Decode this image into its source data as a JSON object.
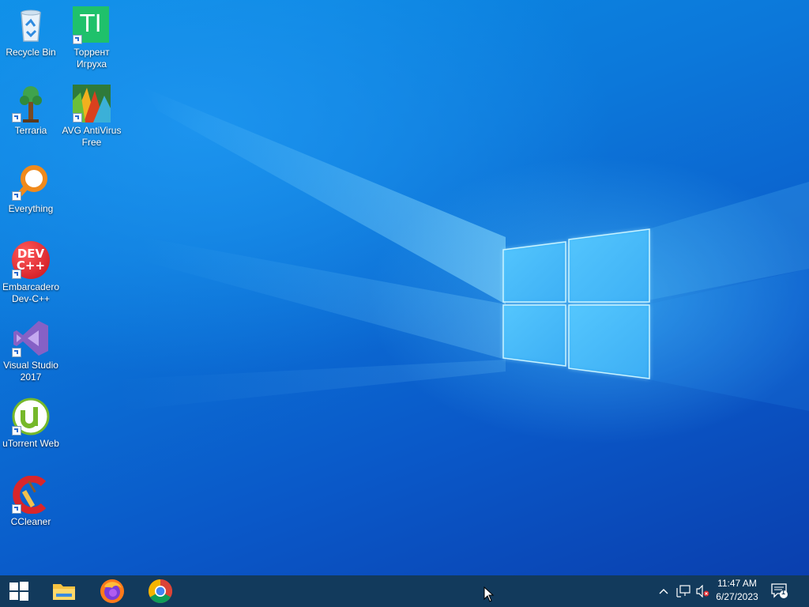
{
  "desktop": {
    "icons": [
      {
        "id": "recycle-bin",
        "label": "Recycle Bin",
        "shortcut": false
      },
      {
        "id": "torrent-igruha",
        "label": "Торрент Игруха",
        "shortcut": true
      },
      {
        "id": "terraria",
        "label": "Terraria",
        "shortcut": true
      },
      {
        "id": "avg-antivirus",
        "label": "AVG AntiVirus Free",
        "shortcut": true
      },
      {
        "id": "everything",
        "label": "Everything",
        "shortcut": true
      },
      {
        "id": "dev-cpp",
        "label": "Embarcadero Dev-C++",
        "shortcut": true
      },
      {
        "id": "visual-studio",
        "label": "Visual Studio 2017",
        "shortcut": true
      },
      {
        "id": "utorrent-web",
        "label": "uTorrent Web",
        "shortcut": true
      },
      {
        "id": "ccleaner",
        "label": "CCleaner",
        "shortcut": true
      }
    ],
    "torrent_icon_text": "TI",
    "devcpp_icon_text": [
      "DEV",
      "C++"
    ]
  },
  "taskbar": {
    "pinned": [
      {
        "name": "start-button",
        "icon": "windows-logo-icon"
      },
      {
        "name": "file-explorer",
        "icon": "folder-icon"
      },
      {
        "name": "firefox",
        "icon": "firefox-icon"
      },
      {
        "name": "chrome",
        "icon": "chrome-icon"
      }
    ],
    "tray": {
      "icons": [
        "chevron-up-icon",
        "network-icon",
        "volume-muted-icon"
      ],
      "time": "11:47 AM",
      "date": "6/27/2023",
      "notification_count": "1"
    }
  },
  "colors": {
    "taskbar": "#123a5c",
    "wallpaper_blue": "#0a78da",
    "torrent_green": "#1fc16b"
  }
}
